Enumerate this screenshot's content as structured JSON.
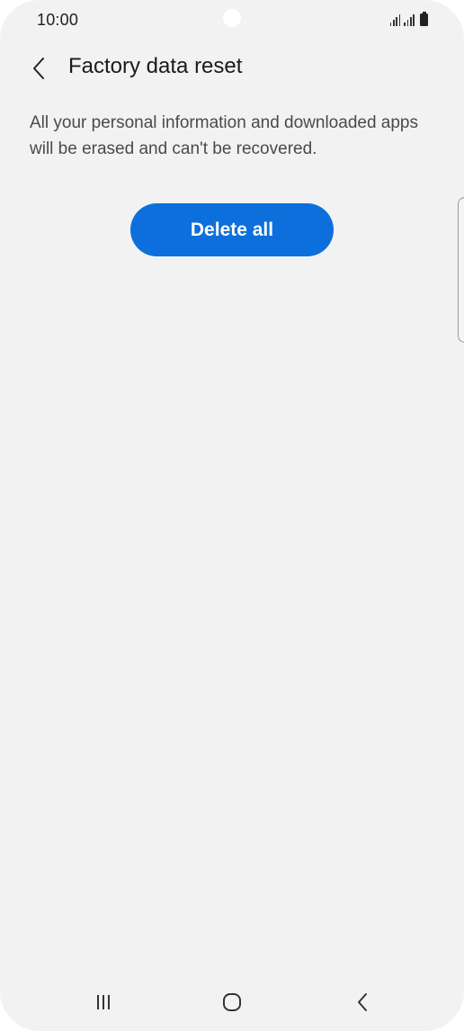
{
  "status_bar": {
    "time": "10:00"
  },
  "header": {
    "title": "Factory data reset",
    "back_icon": "chevron-left-icon"
  },
  "content": {
    "description": "All your personal information and downloaded apps will be erased and can't be recovered.",
    "delete_button_label": "Delete all"
  },
  "nav_bar": {
    "recents_icon": "recents-icon",
    "home_icon": "home-icon",
    "back_icon": "back-icon"
  },
  "colors": {
    "background": "#f2f2f2",
    "accent": "#0c6fdc",
    "title_text": "#1a1a1a",
    "body_text": "#4a4a4a"
  }
}
